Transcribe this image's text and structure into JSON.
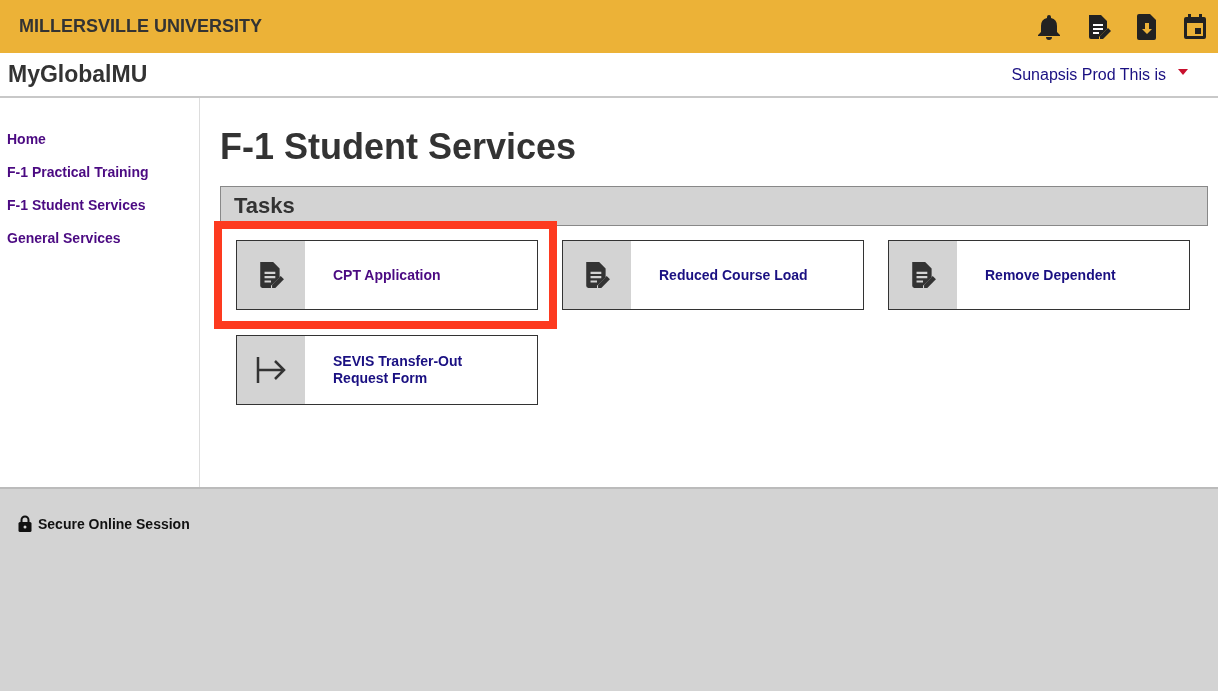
{
  "header": {
    "title": "MILLERSVILLE UNIVERSITY",
    "icons": [
      {
        "kind": "notifications"
      },
      {
        "kind": "forms"
      },
      {
        "kind": "downloads"
      },
      {
        "kind": "calendar"
      }
    ]
  },
  "subheader": {
    "app_name": "MyGlobalMU",
    "user_menu": "Sunapsis Prod This is"
  },
  "sidebar": {
    "items": [
      {
        "label": "Home"
      },
      {
        "label": "F-1 Practical Training"
      },
      {
        "label": "F-1 Student Services"
      },
      {
        "label": "General Services"
      }
    ]
  },
  "page_title": "F-1 Student Services",
  "section": {
    "title": "Tasks"
  },
  "tasks": [
    {
      "label": "CPT Application",
      "kind": "form",
      "visited": true,
      "highlighted": true
    },
    {
      "label": "Reduced Course Load",
      "kind": "form",
      "visited": false,
      "highlighted": false
    },
    {
      "label": "Remove Dependent",
      "kind": "form",
      "visited": false,
      "highlighted": false
    },
    {
      "label": "SEVIS Transfer-Out Request Form",
      "kind": "transfer",
      "visited": false,
      "highlighted": false
    }
  ],
  "footer": {
    "text": "Secure Online Session"
  }
}
